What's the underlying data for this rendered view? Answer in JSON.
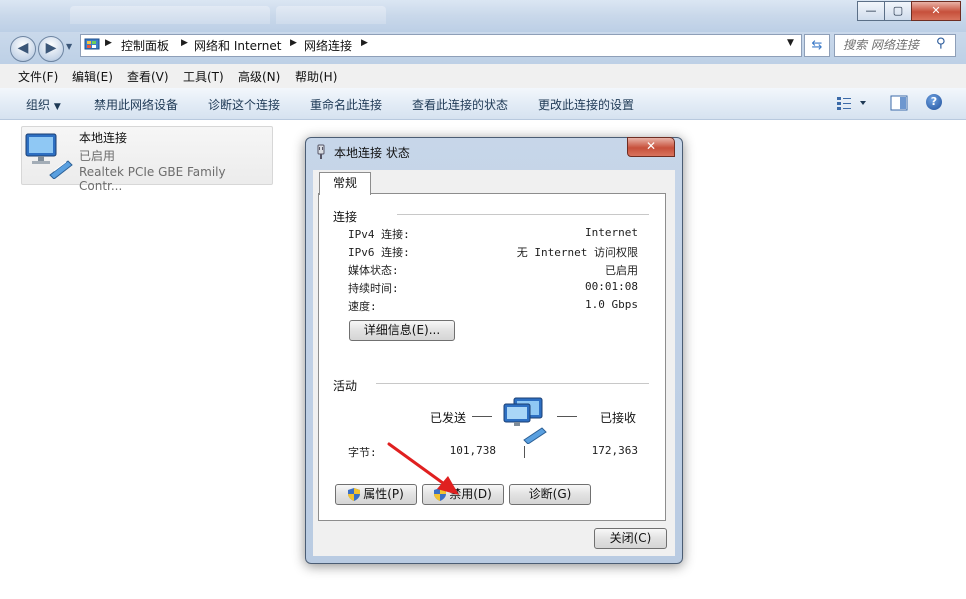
{
  "window": {
    "minimize": "—",
    "maximize": "▢",
    "close": "✕"
  },
  "breadcrumb": [
    "控制面板",
    "网络和 Internet",
    "网络连接"
  ],
  "search": {
    "placeholder": "搜索 网络连接"
  },
  "menu": [
    "文件(F)",
    "编辑(E)",
    "查看(V)",
    "工具(T)",
    "高级(N)",
    "帮助(H)"
  ],
  "commands": {
    "organize": "组织",
    "disable": "禁用此网络设备",
    "diagnose": "诊断这个连接",
    "rename": "重命名此连接",
    "view_status": "查看此连接的状态",
    "change_settings": "更改此连接的设置"
  },
  "adapter": {
    "name": "本地连接",
    "status": "已启用",
    "device": "Realtek PCIe GBE Family Contr..."
  },
  "dialog": {
    "title": "本地连接 状态",
    "close": "✕",
    "tab": "常规",
    "connection": {
      "heading": "连接",
      "rows": [
        {
          "label": "IPv4 连接:",
          "value": "Internet"
        },
        {
          "label": "IPv6 连接:",
          "value": "无 Internet 访问权限"
        },
        {
          "label": "媒体状态:",
          "value": "已启用"
        },
        {
          "label": "持续时间:",
          "value": "00:01:08"
        },
        {
          "label": "速度:",
          "value": "1.0 Gbps"
        }
      ],
      "details_button": "详细信息(E)..."
    },
    "activity": {
      "heading": "活动",
      "sent_label": "已发送",
      "received_label": "已接收",
      "bytes_label": "字节:",
      "bytes_sent": "101,738",
      "bytes_received": "172,363"
    },
    "buttons": {
      "properties": "属性(P)",
      "disable": "禁用(D)",
      "diagnose": "诊断(G)",
      "close": "关闭(C)"
    }
  },
  "colors": {
    "annotation_arrow": "#e02020",
    "accent": "#3b7ac8"
  }
}
